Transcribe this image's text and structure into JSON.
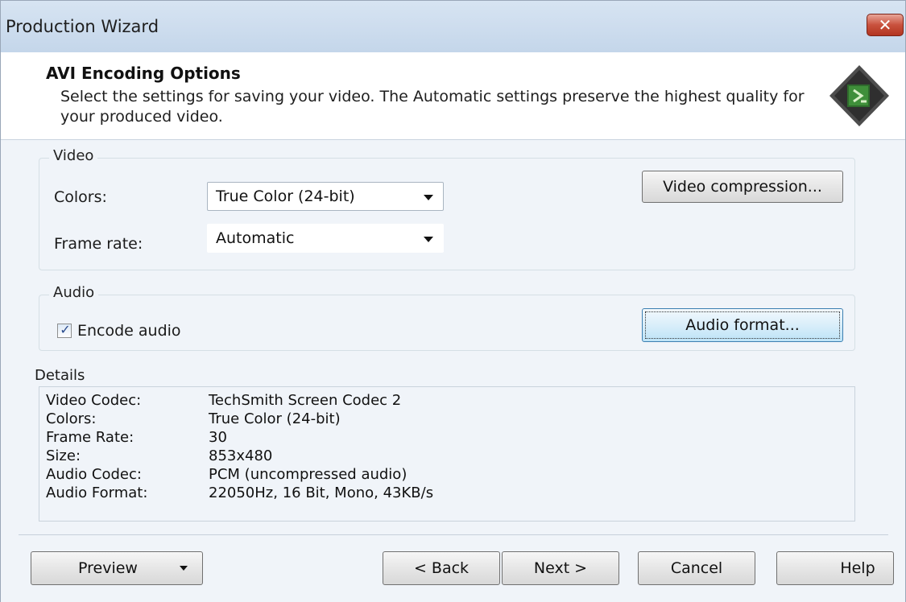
{
  "window": {
    "title": "Production Wizard"
  },
  "header": {
    "title": "AVI Encoding Options",
    "description": "Select the settings for saving your video.  The Automatic settings preserve the highest quality for your produced video."
  },
  "video": {
    "legend": "Video",
    "colors_label": "Colors:",
    "colors_value": "True Color (24-bit)",
    "frame_rate_label": "Frame rate:",
    "frame_rate_value": "Automatic",
    "compression_button": "Video compression..."
  },
  "audio": {
    "legend": "Audio",
    "encode_label": "Encode audio",
    "encode_checked": true,
    "format_button": "Audio format..."
  },
  "details": {
    "legend": "Details",
    "rows": [
      {
        "key": "Video Codec:",
        "value": "TechSmith Screen Codec 2"
      },
      {
        "key": "Colors:",
        "value": "True Color (24-bit)"
      },
      {
        "key": "Frame Rate:",
        "value": "30"
      },
      {
        "key": "Size:",
        "value": "853x480"
      },
      {
        "key": "Audio Codec:",
        "value": "PCM (uncompressed audio)"
      },
      {
        "key": "Audio Format:",
        "value": "22050Hz, 16 Bit, Mono, 43KB/s"
      }
    ]
  },
  "footer": {
    "preview": "Preview",
    "back": "< Back",
    "next": "Next >",
    "cancel": "Cancel",
    "help": "Help"
  },
  "colors": {
    "titlebar": "#c4d6ea",
    "close_button": "#c9513d",
    "panel_background": "#f0f4f9"
  }
}
